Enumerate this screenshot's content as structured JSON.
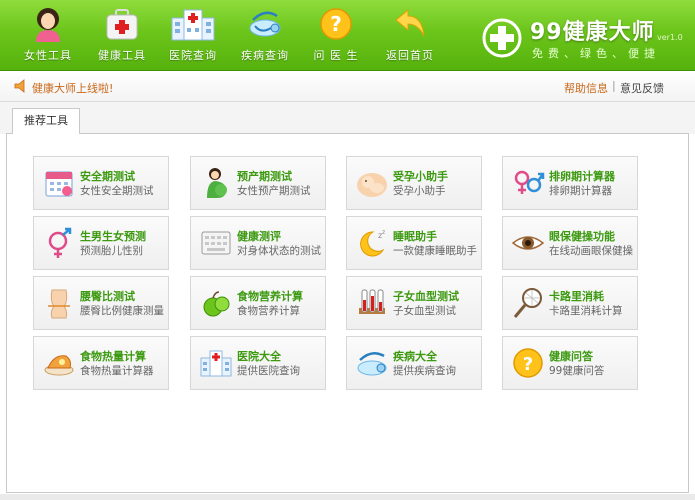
{
  "toolbar": {
    "items": [
      {
        "label": "女性工具",
        "icon": "woman-icon"
      },
      {
        "label": "健康工具",
        "icon": "medkit-icon"
      },
      {
        "label": "医院查询",
        "icon": "hospital-icon"
      },
      {
        "label": "疾病查询",
        "icon": "stethoscope-icon"
      },
      {
        "label": "问 医 生",
        "icon": "question-icon"
      },
      {
        "label": "返回首页",
        "icon": "home-arrow-icon"
      }
    ]
  },
  "brand": {
    "title": "99健康大师",
    "version": "ver1.0",
    "slogan": "免费、绿色、便捷"
  },
  "notice": {
    "message": "健康大师上线啦!",
    "help": "帮助信息",
    "separator": "|",
    "feedback": "意见反馈"
  },
  "tabs": [
    {
      "label": "推荐工具"
    }
  ],
  "cards": [
    {
      "title": "安全期测试",
      "subtitle": "女性安全期测试",
      "icon": "calendar-icon"
    },
    {
      "title": "预产期测试",
      "subtitle": "女性预产期测试",
      "icon": "pregnant-woman-icon"
    },
    {
      "title": "受孕小助手",
      "subtitle": "受孕小助手",
      "icon": "baby-icon"
    },
    {
      "title": "排卵期计算器",
      "subtitle": "排卵期计算器",
      "icon": "gender-symbols-icon"
    },
    {
      "title": "生男生女预测",
      "subtitle": "预测胎儿性别",
      "icon": "gender-predict-icon"
    },
    {
      "title": "健康测评",
      "subtitle": "对身体状态的测试",
      "icon": "keyboard-icon"
    },
    {
      "title": "睡眠助手",
      "subtitle": "一款健康睡眠助手",
      "icon": "moon-icon"
    },
    {
      "title": "眼保健操功能",
      "subtitle": "在线动画眼保健操",
      "icon": "eye-icon"
    },
    {
      "title": "腰臀比测试",
      "subtitle": "腰臀比例健康测量",
      "icon": "body-icon"
    },
    {
      "title": "食物营养计算",
      "subtitle": "食物营养计算",
      "icon": "apple-icon"
    },
    {
      "title": "子女血型测试",
      "subtitle": "子女血型测试",
      "icon": "test-tubes-icon"
    },
    {
      "title": "卡路里消耗",
      "subtitle": "卡路里消耗计算",
      "icon": "racket-icon"
    },
    {
      "title": "食物热量计算",
      "subtitle": "食物热量计算器",
      "icon": "food-icon"
    },
    {
      "title": "医院大全",
      "subtitle": "提供医院查询",
      "icon": "hospital-small-icon"
    },
    {
      "title": "疾病大全",
      "subtitle": "提供疾病查询",
      "icon": "stethoscope-small-icon"
    },
    {
      "title": "健康问答",
      "subtitle": "99健康问答",
      "icon": "question-small-icon"
    }
  ],
  "colors": {
    "toolbar_green": "#6cc51b",
    "card_title": "#3c9a10",
    "notice_text": "#c8681a"
  }
}
